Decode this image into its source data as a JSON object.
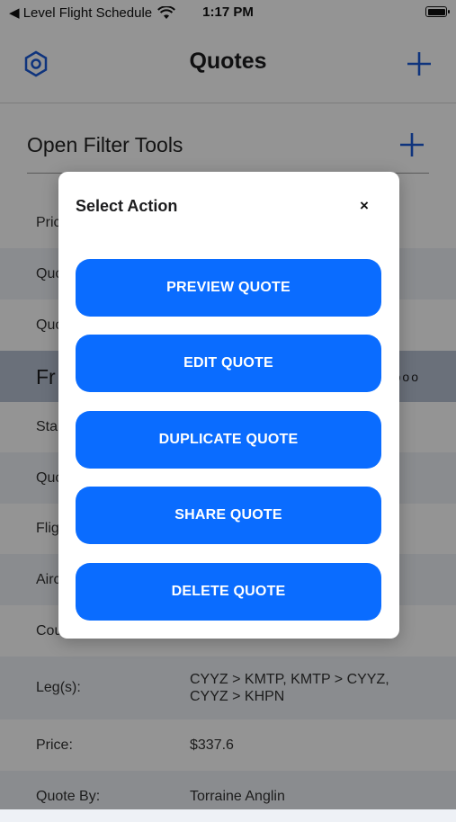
{
  "status_bar": {
    "back_app_label": "◀ Level Flight Schedule",
    "time": "1:17 PM"
  },
  "nav": {
    "title": "Quotes"
  },
  "filter": {
    "label": "Open Filter Tools"
  },
  "list": {
    "rows_top": [
      {
        "label": "Pric"
      },
      {
        "label": "Quo"
      },
      {
        "label": "Quo"
      }
    ],
    "group_title": "Fr",
    "group_more": "ooo",
    "rows_bottom": [
      {
        "label": "Sta"
      },
      {
        "label": "Quo"
      },
      {
        "label": "Flig"
      },
      {
        "label": "Airc"
      },
      {
        "label": "Cou"
      },
      {
        "label": "Leg(s):",
        "value_line1": "CYYZ > KMTP, KMTP > CYYZ,",
        "value_line2": "CYYZ > KHPN"
      },
      {
        "label": "Price:",
        "value": "$337.6"
      },
      {
        "label": "Quote By:",
        "value": "Torraine Anglin"
      }
    ]
  },
  "modal": {
    "title": "Select Action",
    "close": "×",
    "actions": [
      "PREVIEW QUOTE",
      "EDIT QUOTE",
      "DUPLICATE QUOTE",
      "SHARE QUOTE",
      "DELETE QUOTE"
    ]
  },
  "colors": {
    "accent": "#0a6cff",
    "row_alt": "#eef1f6",
    "group_header": "#b7c1d3"
  }
}
